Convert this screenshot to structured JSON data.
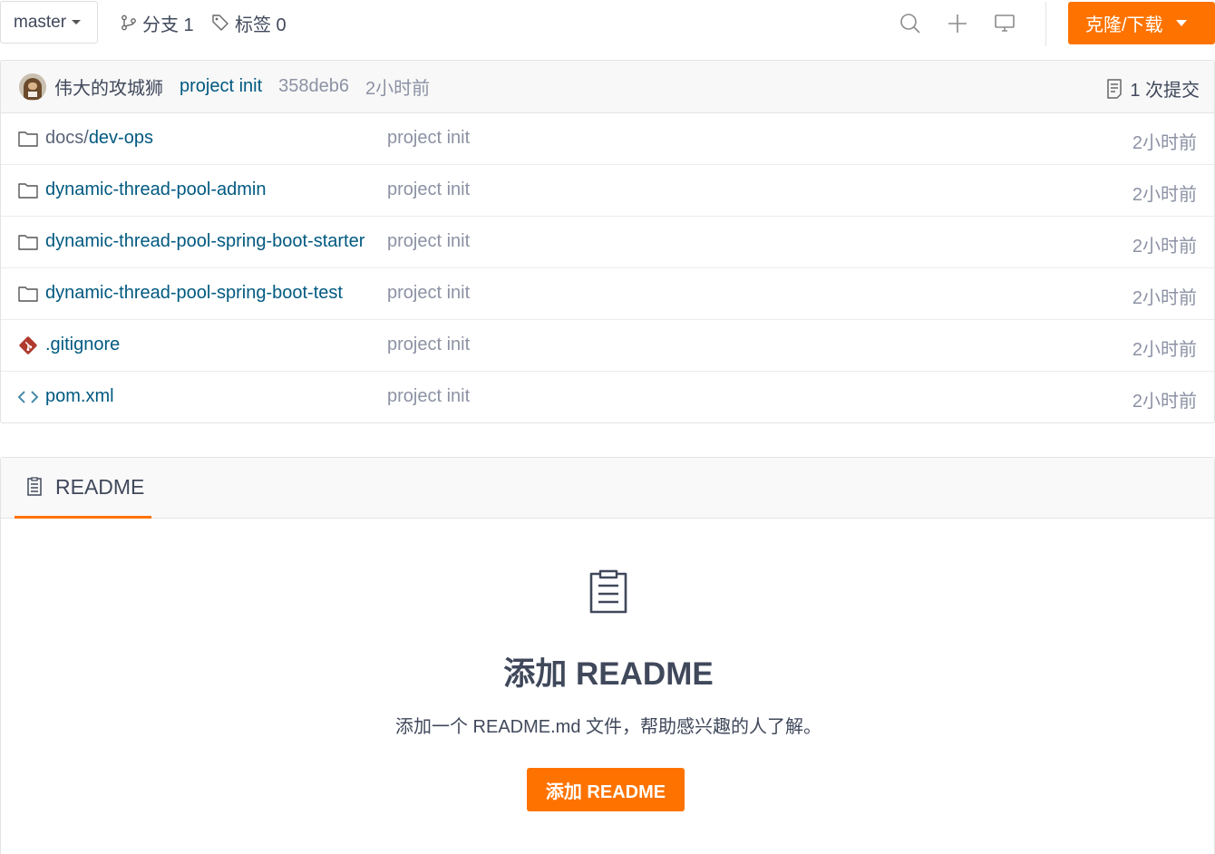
{
  "toolbar": {
    "branch": "master",
    "branches_label": "分支 1",
    "tags_label": "标签 0",
    "clone_label": "克隆/下载"
  },
  "commit": {
    "author": "伟大的攻城狮",
    "message": "project init",
    "sha": "358deb6",
    "time": "2小时前",
    "count_label": "1 次提交"
  },
  "files": [
    {
      "type": "folder",
      "name_prefix": "docs/",
      "name": "dev-ops",
      "message": "project init",
      "time": "2小时前"
    },
    {
      "type": "folder",
      "name_prefix": "",
      "name": "dynamic-thread-pool-admin",
      "message": "project init",
      "time": "2小时前"
    },
    {
      "type": "folder",
      "name_prefix": "",
      "name": "dynamic-thread-pool-spring-boot-starter",
      "message": "project init",
      "time": "2小时前"
    },
    {
      "type": "folder",
      "name_prefix": "",
      "name": "dynamic-thread-pool-spring-boot-test",
      "message": "project init",
      "time": "2小时前"
    },
    {
      "type": "git",
      "name_prefix": "",
      "name": ".gitignore",
      "message": "project init",
      "time": "2小时前"
    },
    {
      "type": "code",
      "name_prefix": "",
      "name": "pom.xml",
      "message": "project init",
      "time": "2小时前"
    }
  ],
  "readme": {
    "tab_label": "README",
    "title": "添加 README",
    "description": "添加一个 README.md 文件，帮助感兴趣的人了解。",
    "button_label": "添加 README"
  },
  "colors": {
    "accent": "#fe7300",
    "link": "#005980",
    "muted": "#8c92a4",
    "text": "#40485b"
  },
  "icons": {
    "branch": "branch-icon",
    "tag": "tag-icon",
    "search": "search-icon",
    "add": "plus-icon",
    "monitor": "monitor-icon",
    "commits": "commit-log-icon",
    "folder": "folder-icon",
    "git": "git-icon",
    "code": "code-icon",
    "readme": "readme-doc-icon"
  }
}
